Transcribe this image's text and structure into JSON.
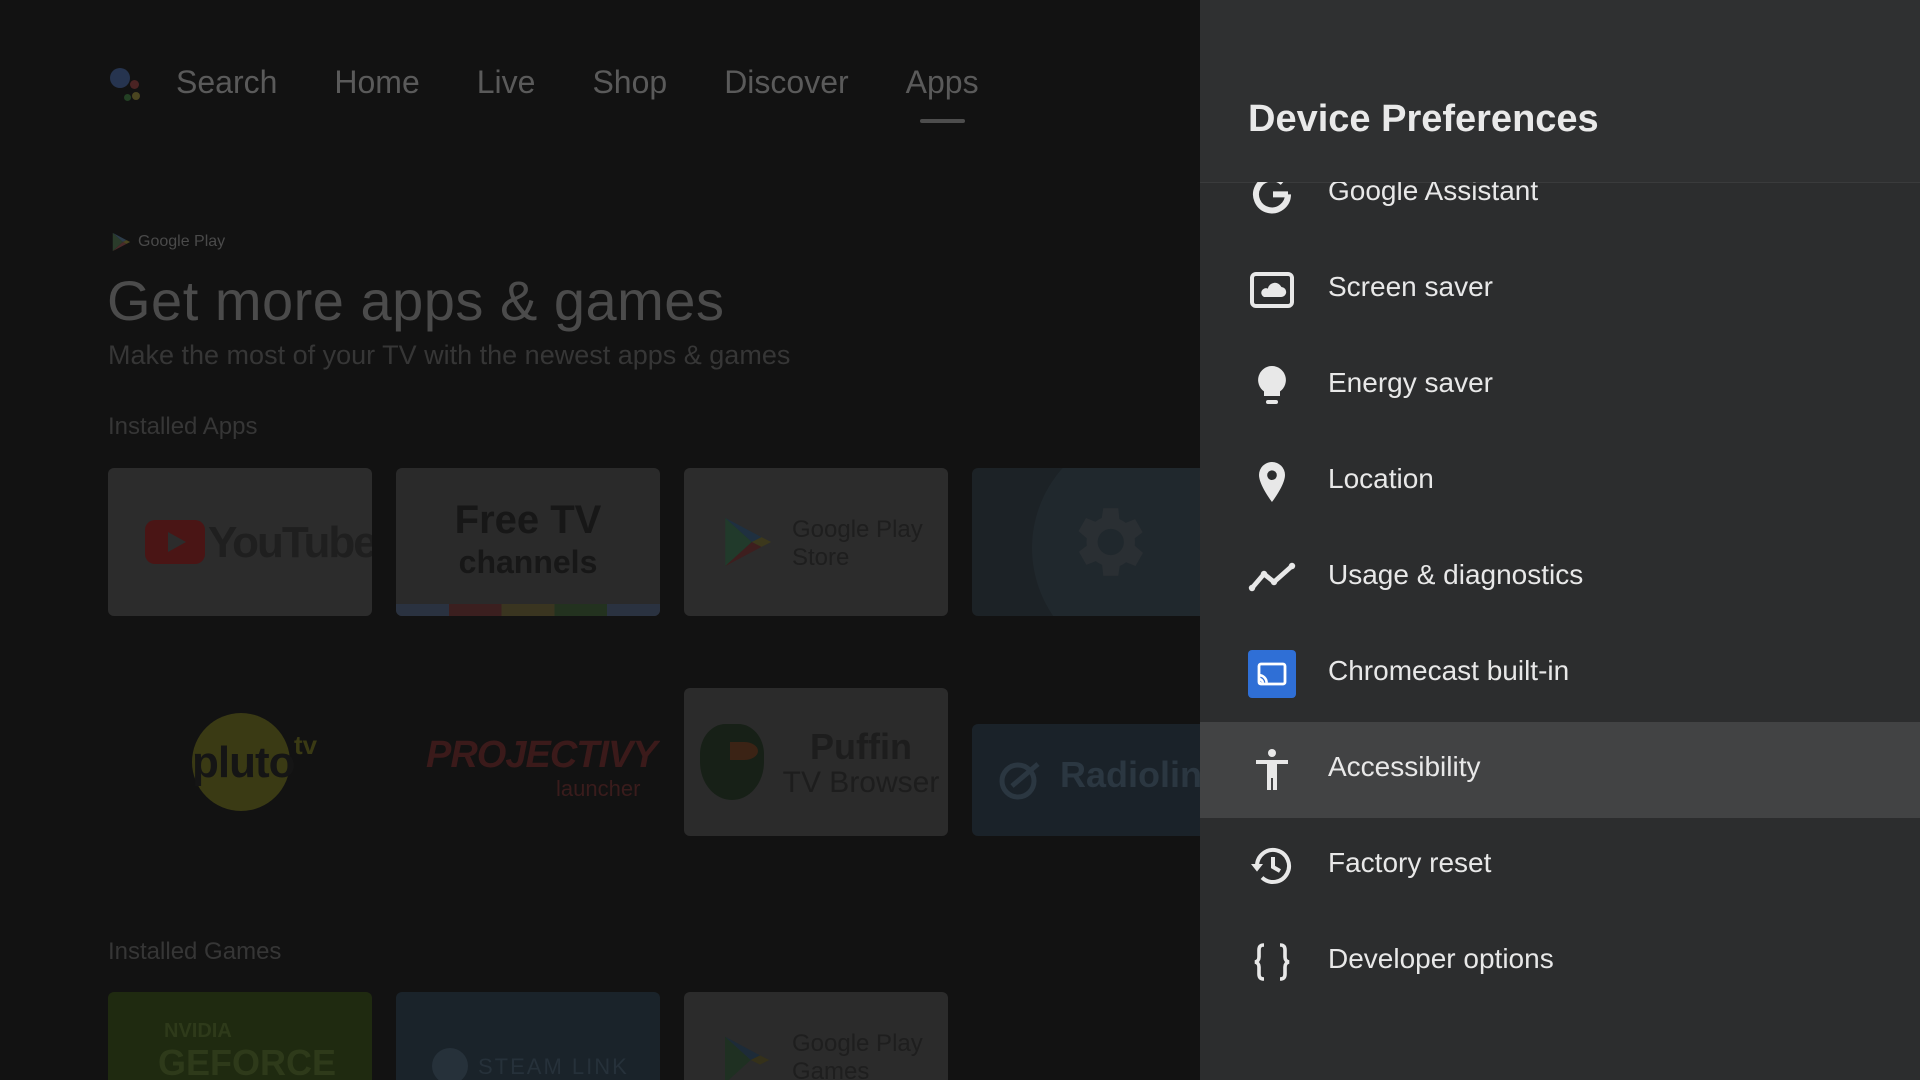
{
  "launcher": {
    "nav": [
      {
        "label": "Search",
        "active": false
      },
      {
        "label": "Home",
        "active": false
      },
      {
        "label": "Live",
        "active": false
      },
      {
        "label": "Shop",
        "active": false
      },
      {
        "label": "Discover",
        "active": false
      },
      {
        "label": "Apps",
        "active": true
      }
    ],
    "badge": "Google Play",
    "hero_title": "Get more apps & games",
    "hero_subtitle": "Make the most of your TV with the newest apps & games",
    "installed_apps_label": "Installed Apps",
    "installed_games_label": "Installed Games",
    "apps": [
      {
        "name": "YouTube",
        "text": "YouTube"
      },
      {
        "name": "Free TV channels",
        "text_line1": "Free TV",
        "text_line2": "channels"
      },
      {
        "name": "Google Play Store",
        "text_line1": "Google Play",
        "text_line2": "Store"
      },
      {
        "name": "Settings",
        "icon": "gear-icon"
      },
      {
        "name": "Pluto TV",
        "text": "pluto",
        "suffix": "tv"
      },
      {
        "name": "Projectivy launcher",
        "text": "PROJECTIVY",
        "suffix": "launcher"
      },
      {
        "name": "Puffin TV Browser",
        "text_line1": "Puffin",
        "text_line2": "TV Browser"
      },
      {
        "name": "Radioline",
        "text": "Radioline"
      }
    ],
    "games": [
      {
        "name": "NVIDIA GeForce",
        "text_line1": "NVIDIA",
        "text_line2": "GEFORCE"
      },
      {
        "name": "Steam Link",
        "text": "STEAM LINK"
      },
      {
        "name": "Google Play Games",
        "text_line1": "Google Play",
        "text_line2": "Games"
      }
    ]
  },
  "panel": {
    "title": "Device Preferences",
    "items": [
      {
        "label": "Google Assistant",
        "icon": "google-g-icon",
        "focused": false
      },
      {
        "label": "Screen saver",
        "icon": "screen-saver-icon",
        "focused": false
      },
      {
        "label": "Energy saver",
        "icon": "lightbulb-icon",
        "focused": false
      },
      {
        "label": "Location",
        "icon": "location-pin-icon",
        "focused": false
      },
      {
        "label": "Usage & diagnostics",
        "icon": "trend-line-icon",
        "focused": false
      },
      {
        "label": "Chromecast built-in",
        "icon": "cast-icon",
        "focused": false
      },
      {
        "label": "Accessibility",
        "icon": "accessibility-icon",
        "focused": true
      },
      {
        "label": "Factory reset",
        "icon": "history-icon",
        "focused": false
      },
      {
        "label": "Developer options",
        "icon": "braces-icon",
        "focused": false
      }
    ]
  },
  "colors": {
    "panel_bg": "#2c2d2e",
    "focused_row": "#424344",
    "cast_accent": "#2f6fd6"
  }
}
